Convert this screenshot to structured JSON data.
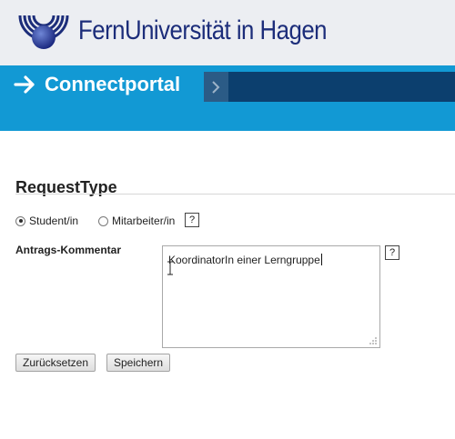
{
  "header": {
    "university_name": "FernUniversität in Hagen",
    "logo_icon": "fernuni-globe-logo"
  },
  "banner": {
    "title": "Connectportal",
    "arrow_icon": "right-arrow-icon",
    "nav_icon": "chevron-right-icon"
  },
  "form": {
    "section_title": "RequestType",
    "request_type_options": [
      {
        "label": "Student/in",
        "selected": true
      },
      {
        "label": "Mitarbeiter/in",
        "selected": false
      }
    ],
    "help_label": "?",
    "comment_label": "Antrags-Kommentar",
    "comment_value": "KoordinatorIn einer Lerngruppe",
    "buttons": {
      "reset": "Zurücksetzen",
      "save": "Speichern"
    }
  },
  "colors": {
    "brand_navy": "#1c2d7a",
    "banner_blue": "#1299d4",
    "banner_dark": "#0c3f6e"
  }
}
